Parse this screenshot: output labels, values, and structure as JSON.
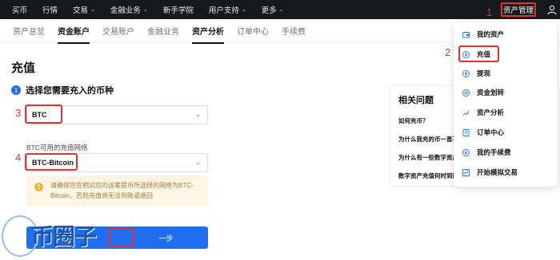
{
  "topnav": {
    "items": [
      "买币",
      "行情",
      "交易",
      "金融业务",
      "新手学院",
      "用户支持",
      "更多"
    ],
    "asset_management": "资产管理"
  },
  "subnav": {
    "tabs": [
      "资产总览",
      "资金账户",
      "交易账户",
      "金融业务",
      "资产分析",
      "订单中心",
      "手续费"
    ]
  },
  "page": {
    "title": "充值",
    "step_number": "1",
    "step_label": "选择您需要充入的币种"
  },
  "coin_select": {
    "value": "BTC"
  },
  "network": {
    "label": "BTC可用的充值网络",
    "value": "BTC-Bitcoin"
  },
  "warning": {
    "text": "请确保您在相对应的该笔提币所选择的网络为BTC-Bitcoin，否则充值将无法到账或退回"
  },
  "next_button": {
    "label": "一步"
  },
  "watermark": {
    "text": "币圈子"
  },
  "annotations": [
    "1",
    "2",
    "3",
    "4"
  ],
  "related": {
    "title": "相关问题",
    "questions": [
      "如何充币？",
      "为什么我充的币一直不到账？",
      "为什么有一些数字资产不能充值？",
      "数字资产充值何时到账？"
    ]
  },
  "dropdown": {
    "items": [
      {
        "label": "我的资产",
        "icon": "wallet-icon"
      },
      {
        "label": "充值",
        "icon": "deposit-icon"
      },
      {
        "label": "提现",
        "icon": "withdraw-icon"
      },
      {
        "label": "资金划转",
        "icon": "transfer-icon"
      },
      {
        "label": "资产分析",
        "icon": "chart-icon"
      },
      {
        "label": "订单中心",
        "icon": "order-icon"
      },
      {
        "label": "我的手续费",
        "icon": "fee-icon"
      },
      {
        "label": "开始模拟交易",
        "icon": "simulation-icon"
      }
    ]
  },
  "colors": {
    "accent": "#1f6ef0",
    "annotation_red": "#e0332f",
    "nav_bg": "#17181b"
  }
}
